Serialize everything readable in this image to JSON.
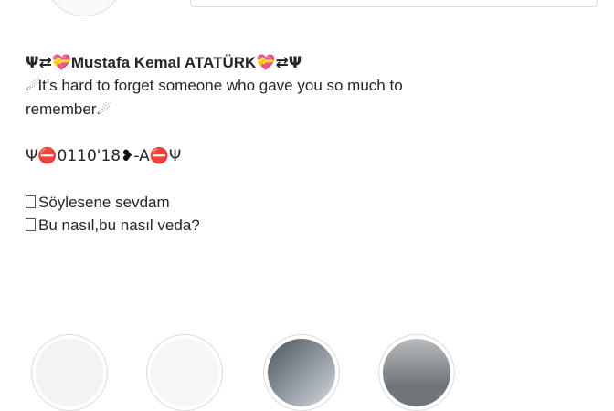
{
  "profile": {
    "bio": {
      "name_line": {
        "prefix_glyphs": "Ψ⇄💝",
        "name": "Mustafa Kemal ATATÜRK",
        "suffix_glyphs": "💝⇄Ψ"
      },
      "quote_line_1": "It's hard to forget someone who gave you so much to",
      "quote_line_2": "remember",
      "quote_glyph": "☄",
      "date_line": {
        "lead": "Ψ⛔0110'18",
        "heart": "❥",
        "tail": " -A⛔Ψ"
      },
      "lyric_1": "Söylesene sevdam",
      "lyric_2": "Bu nasıl,bu nasıl veda?"
    }
  },
  "highlights": [
    {
      "icon": "clock-icon",
      "color": "#f3f3f3"
    },
    {
      "icon": "photo-icon",
      "color": "#f6f6f6"
    },
    {
      "icon": "photo-icon",
      "color": "#9aa2a8"
    },
    {
      "icon": "photo-icon",
      "color": "#6f7478"
    }
  ]
}
